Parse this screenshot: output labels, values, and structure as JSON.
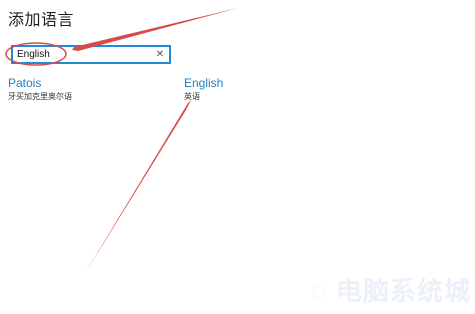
{
  "dialog": {
    "title": "添加语言"
  },
  "search": {
    "value": "English",
    "clear_icon": "close-icon"
  },
  "results": [
    {
      "name": "Patois",
      "native": "牙买加克里奥尔语"
    },
    {
      "name": "English",
      "native": "英语"
    }
  ],
  "colors": {
    "accent": "#1f8ad6",
    "link": "#1f7fc4",
    "annotation": "#d94a4a"
  }
}
